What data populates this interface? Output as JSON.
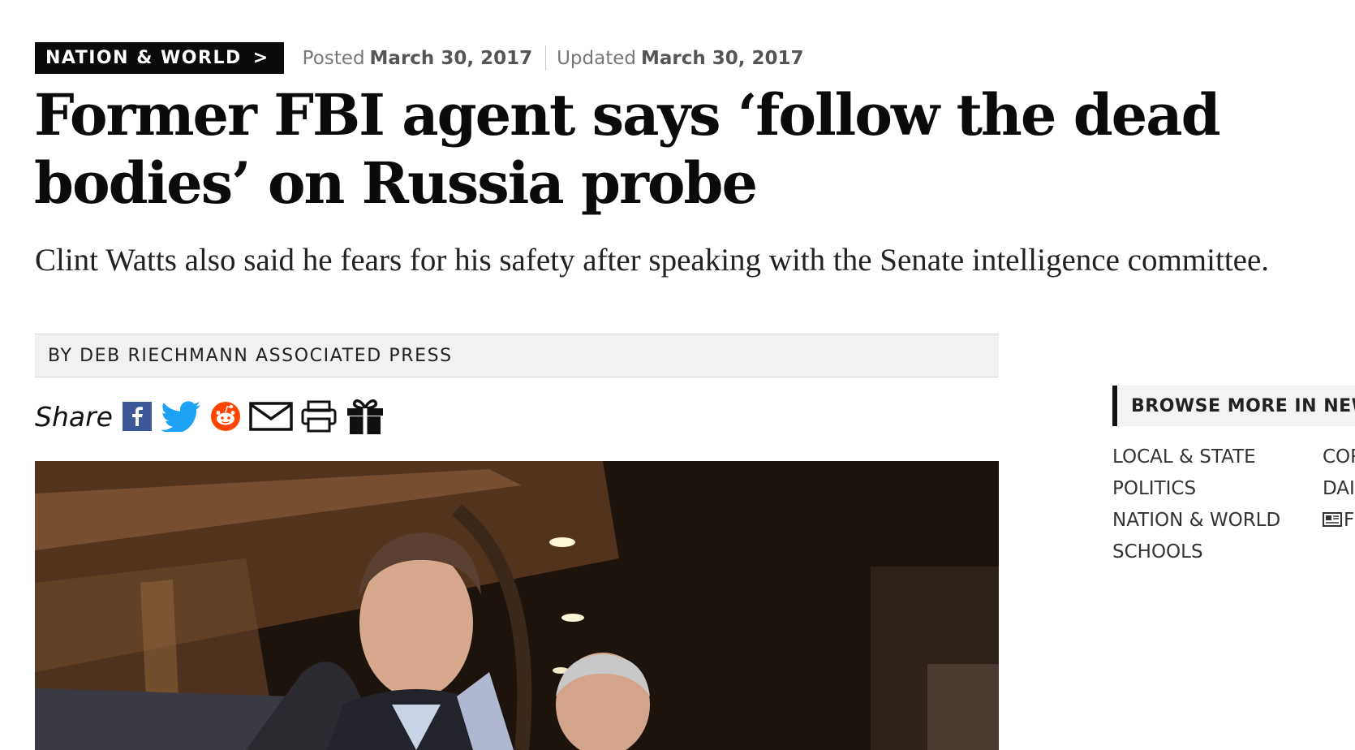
{
  "header": {
    "section_label": "NATION & WORLD",
    "section_chevron": ">",
    "posted_label": "Posted",
    "posted_date": "March 30, 2017",
    "updated_label": "Updated",
    "updated_date": "March 30, 2017"
  },
  "article": {
    "headline": "Former FBI agent says ‘follow the dead bodies’ on Russia probe",
    "dek": "Clint Watts also said he fears for his safety after speaking with the Senate intelligence committee.",
    "byline": "BY DEB RIECHMANN ASSOCIATED PRESS"
  },
  "share": {
    "label": "Share",
    "icons": [
      "facebook-icon",
      "twitter-icon",
      "reddit-icon",
      "email-icon",
      "print-icon",
      "gift-icon"
    ],
    "colors": {
      "facebook": "#3b5998",
      "twitter": "#1da1f2",
      "reddit": "#ff4500"
    }
  },
  "sidebar": {
    "title": "BROWSE MORE IN NEWS",
    "col1": [
      "LOCAL & STATE",
      "POLITICS",
      "NATION & WORLD",
      "SCHOOLS"
    ],
    "col2": [
      "COR",
      "DAI",
      "F"
    ],
    "col2_icons": [
      "newspaper-icon"
    ]
  }
}
